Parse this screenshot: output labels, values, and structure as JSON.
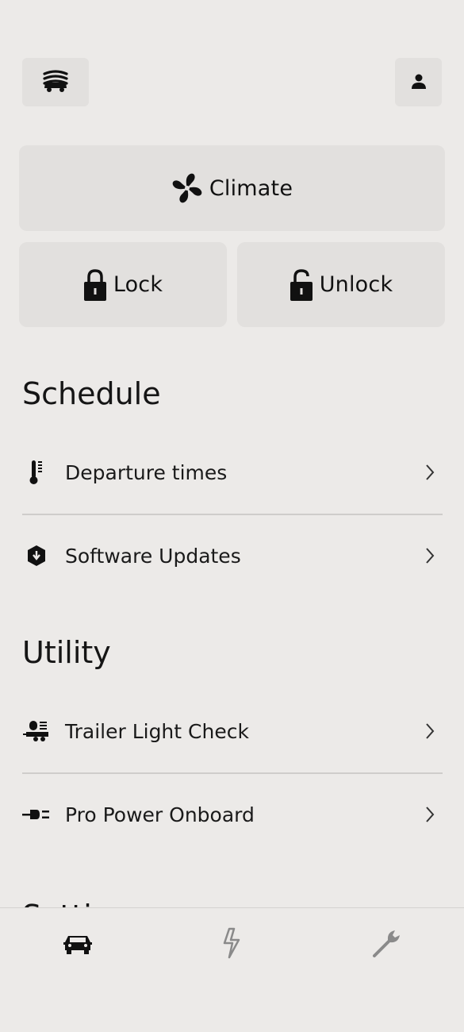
{
  "header": {
    "vehicle_icon": "vehicle-selector-icon",
    "profile_icon": "person-icon"
  },
  "controls": {
    "climate": {
      "label": "Climate",
      "icon": "fan-icon"
    },
    "lock": {
      "label": "Lock",
      "icon": "lock-closed-icon"
    },
    "unlock": {
      "label": "Unlock",
      "icon": "lock-open-icon"
    }
  },
  "schedule": {
    "title": "Schedule",
    "items": [
      {
        "label": "Departure times",
        "icon": "thermometer-icon"
      },
      {
        "label": "Software Updates",
        "icon": "shield-download-icon"
      }
    ]
  },
  "utility": {
    "title": "Utility",
    "items": [
      {
        "label": "Trailer Light Check",
        "icon": "trailer-lights-icon"
      },
      {
        "label": "Pro Power Onboard",
        "icon": "power-plug-icon"
      }
    ]
  },
  "next_section": {
    "title": "Settings"
  },
  "bottom_nav": {
    "items": [
      {
        "name": "vehicle",
        "icon": "car-icon",
        "active": true
      },
      {
        "name": "energy",
        "icon": "lightning-icon",
        "active": false
      },
      {
        "name": "service",
        "icon": "wrench-icon",
        "active": false
      }
    ]
  },
  "colors": {
    "background": "#ECEAE8",
    "tile": "#E2E0DE",
    "text": "#1a1a1a",
    "inactive_icon": "#8a8a8a"
  }
}
